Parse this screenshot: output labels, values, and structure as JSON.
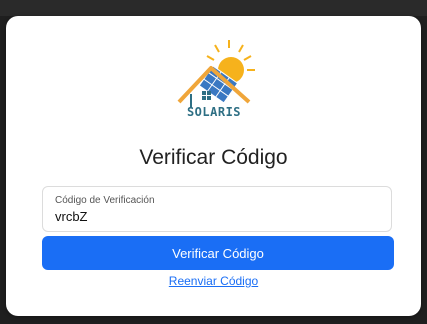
{
  "brand": {
    "name": "SOLARIS",
    "logo_icon": "solar-house-logo"
  },
  "title": "Verificar Código",
  "form": {
    "code_label": "Código de Verificación",
    "code_value": "vrcbZ"
  },
  "actions": {
    "verify_label": "Verificar Código",
    "resend_label": "Reenviar Código"
  },
  "colors": {
    "primary": "#1a6ef5",
    "brand_text": "#2e6f84",
    "sun": "#f6b21c",
    "roof": "#f0a63a"
  }
}
